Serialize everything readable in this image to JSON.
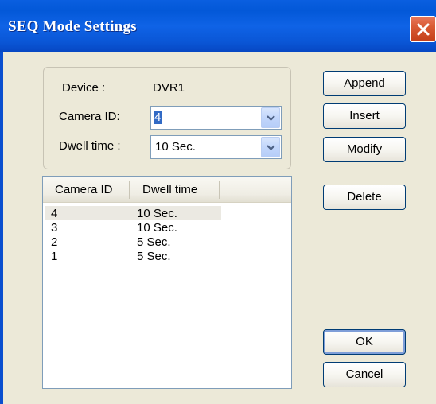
{
  "window": {
    "title": "SEQ Mode Settings",
    "close_icon": "close-icon"
  },
  "form": {
    "device_label": "Device :",
    "device_value": "DVR1",
    "camera_id_label": "Camera ID:",
    "camera_id_value": "4",
    "dwell_time_label": "Dwell time :",
    "dwell_time_value": "10 Sec."
  },
  "list": {
    "columns": [
      "Camera ID",
      "Dwell time"
    ],
    "rows": [
      {
        "camera_id": "4",
        "dwell_time": "10 Sec.",
        "selected": true
      },
      {
        "camera_id": "3",
        "dwell_time": "10 Sec."
      },
      {
        "camera_id": "2",
        "dwell_time": "5 Sec."
      },
      {
        "camera_id": "1",
        "dwell_time": "5 Sec."
      }
    ]
  },
  "buttons": {
    "append": "Append",
    "insert": "Insert",
    "modify": "Modify",
    "delete": "Delete",
    "ok": "OK",
    "cancel": "Cancel"
  },
  "colors": {
    "titlebar": "#0a5fe0",
    "close": "#d95b35",
    "selection": "#316ac5"
  }
}
